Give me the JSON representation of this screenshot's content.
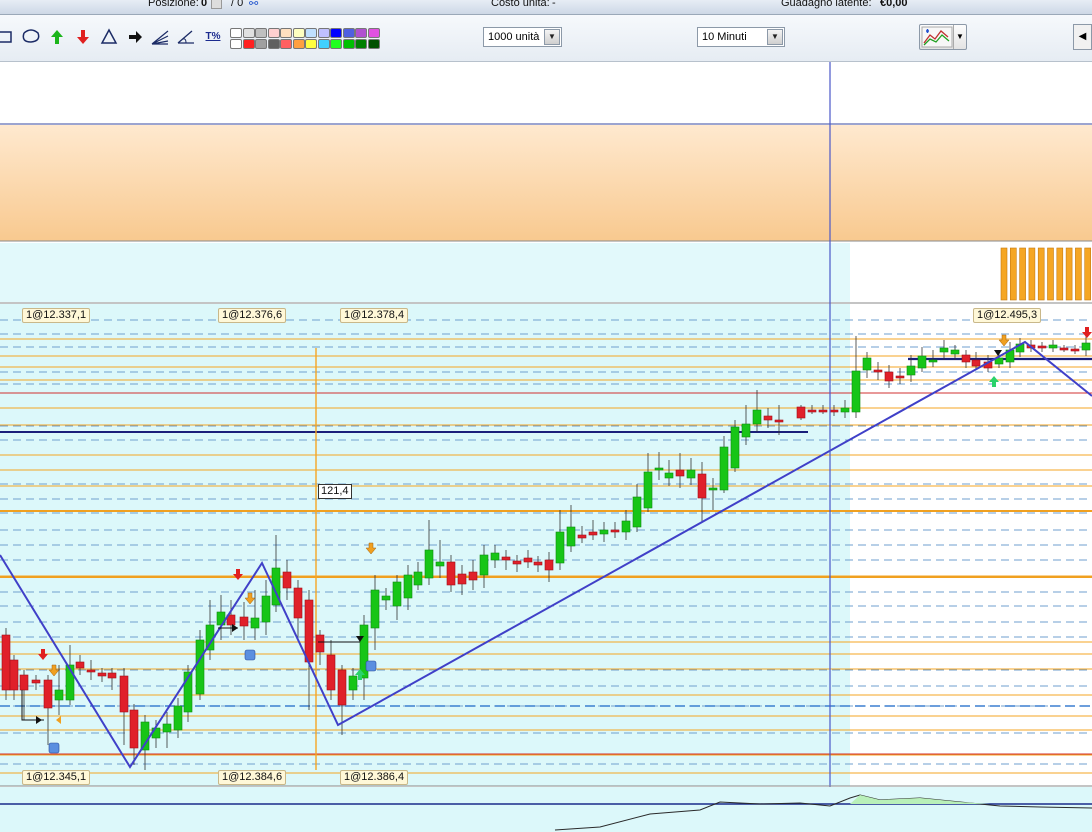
{
  "header": {
    "position_label": "Posizione:",
    "position_value": "0",
    "position_sep": "/ 0",
    "unit_cost_label": "Costo unità:",
    "unit_cost_value": "-",
    "latent_gain_label": "Guadagno latente:",
    "latent_gain_value": "€0,00"
  },
  "toolbar": {
    "tools": [
      "rectangle-icon",
      "ellipse-icon",
      "buy-arrow-icon",
      "sell-arrow-icon",
      "triangle-icon",
      "exit-arrow-icon",
      "fan-icon",
      "angle-icon"
    ],
    "percent_tool_label": "T%",
    "colors_row1": [
      "#ffffff",
      "#e0e0e0",
      "#c0c0c0",
      "#ffd0d0",
      "#ffe0c0",
      "#ffffc0",
      "#c0e0ff",
      "#c0c0ff",
      "#0000ff",
      "#5060e0",
      "#b050d0",
      "#e050e0"
    ],
    "colors_row2": [
      "#ffffff",
      "#ff2020",
      "#a0a0a0",
      "#606060",
      "#ff6060",
      "#ffa040",
      "#ffff40",
      "#40d0ff",
      "#20ff20",
      "#00c000",
      "#008000",
      "#005000"
    ],
    "quantity_select": "1000 unità",
    "timeframe_select": "10 Minuti",
    "edge_button_label": "◀"
  },
  "chart": {
    "high_labels": [
      {
        "text": "1@12.337,1"
      },
      {
        "text": "1@12.376,6"
      },
      {
        "text": "1@12.378,4"
      },
      {
        "text": "1@12.495,3"
      }
    ],
    "low_labels": [
      {
        "text": "1@12.345,1"
      },
      {
        "text": "1@12.384,6"
      },
      {
        "text": "1@12.386,4"
      }
    ],
    "value_marker": "121,4",
    "colors": {
      "bull": "#17c517",
      "bear": "#e0202a",
      "zigzag": "#4040c8",
      "background": "#dcf8fa",
      "fib": "#f5a623",
      "resistance": "#1a1f7a"
    }
  }
}
